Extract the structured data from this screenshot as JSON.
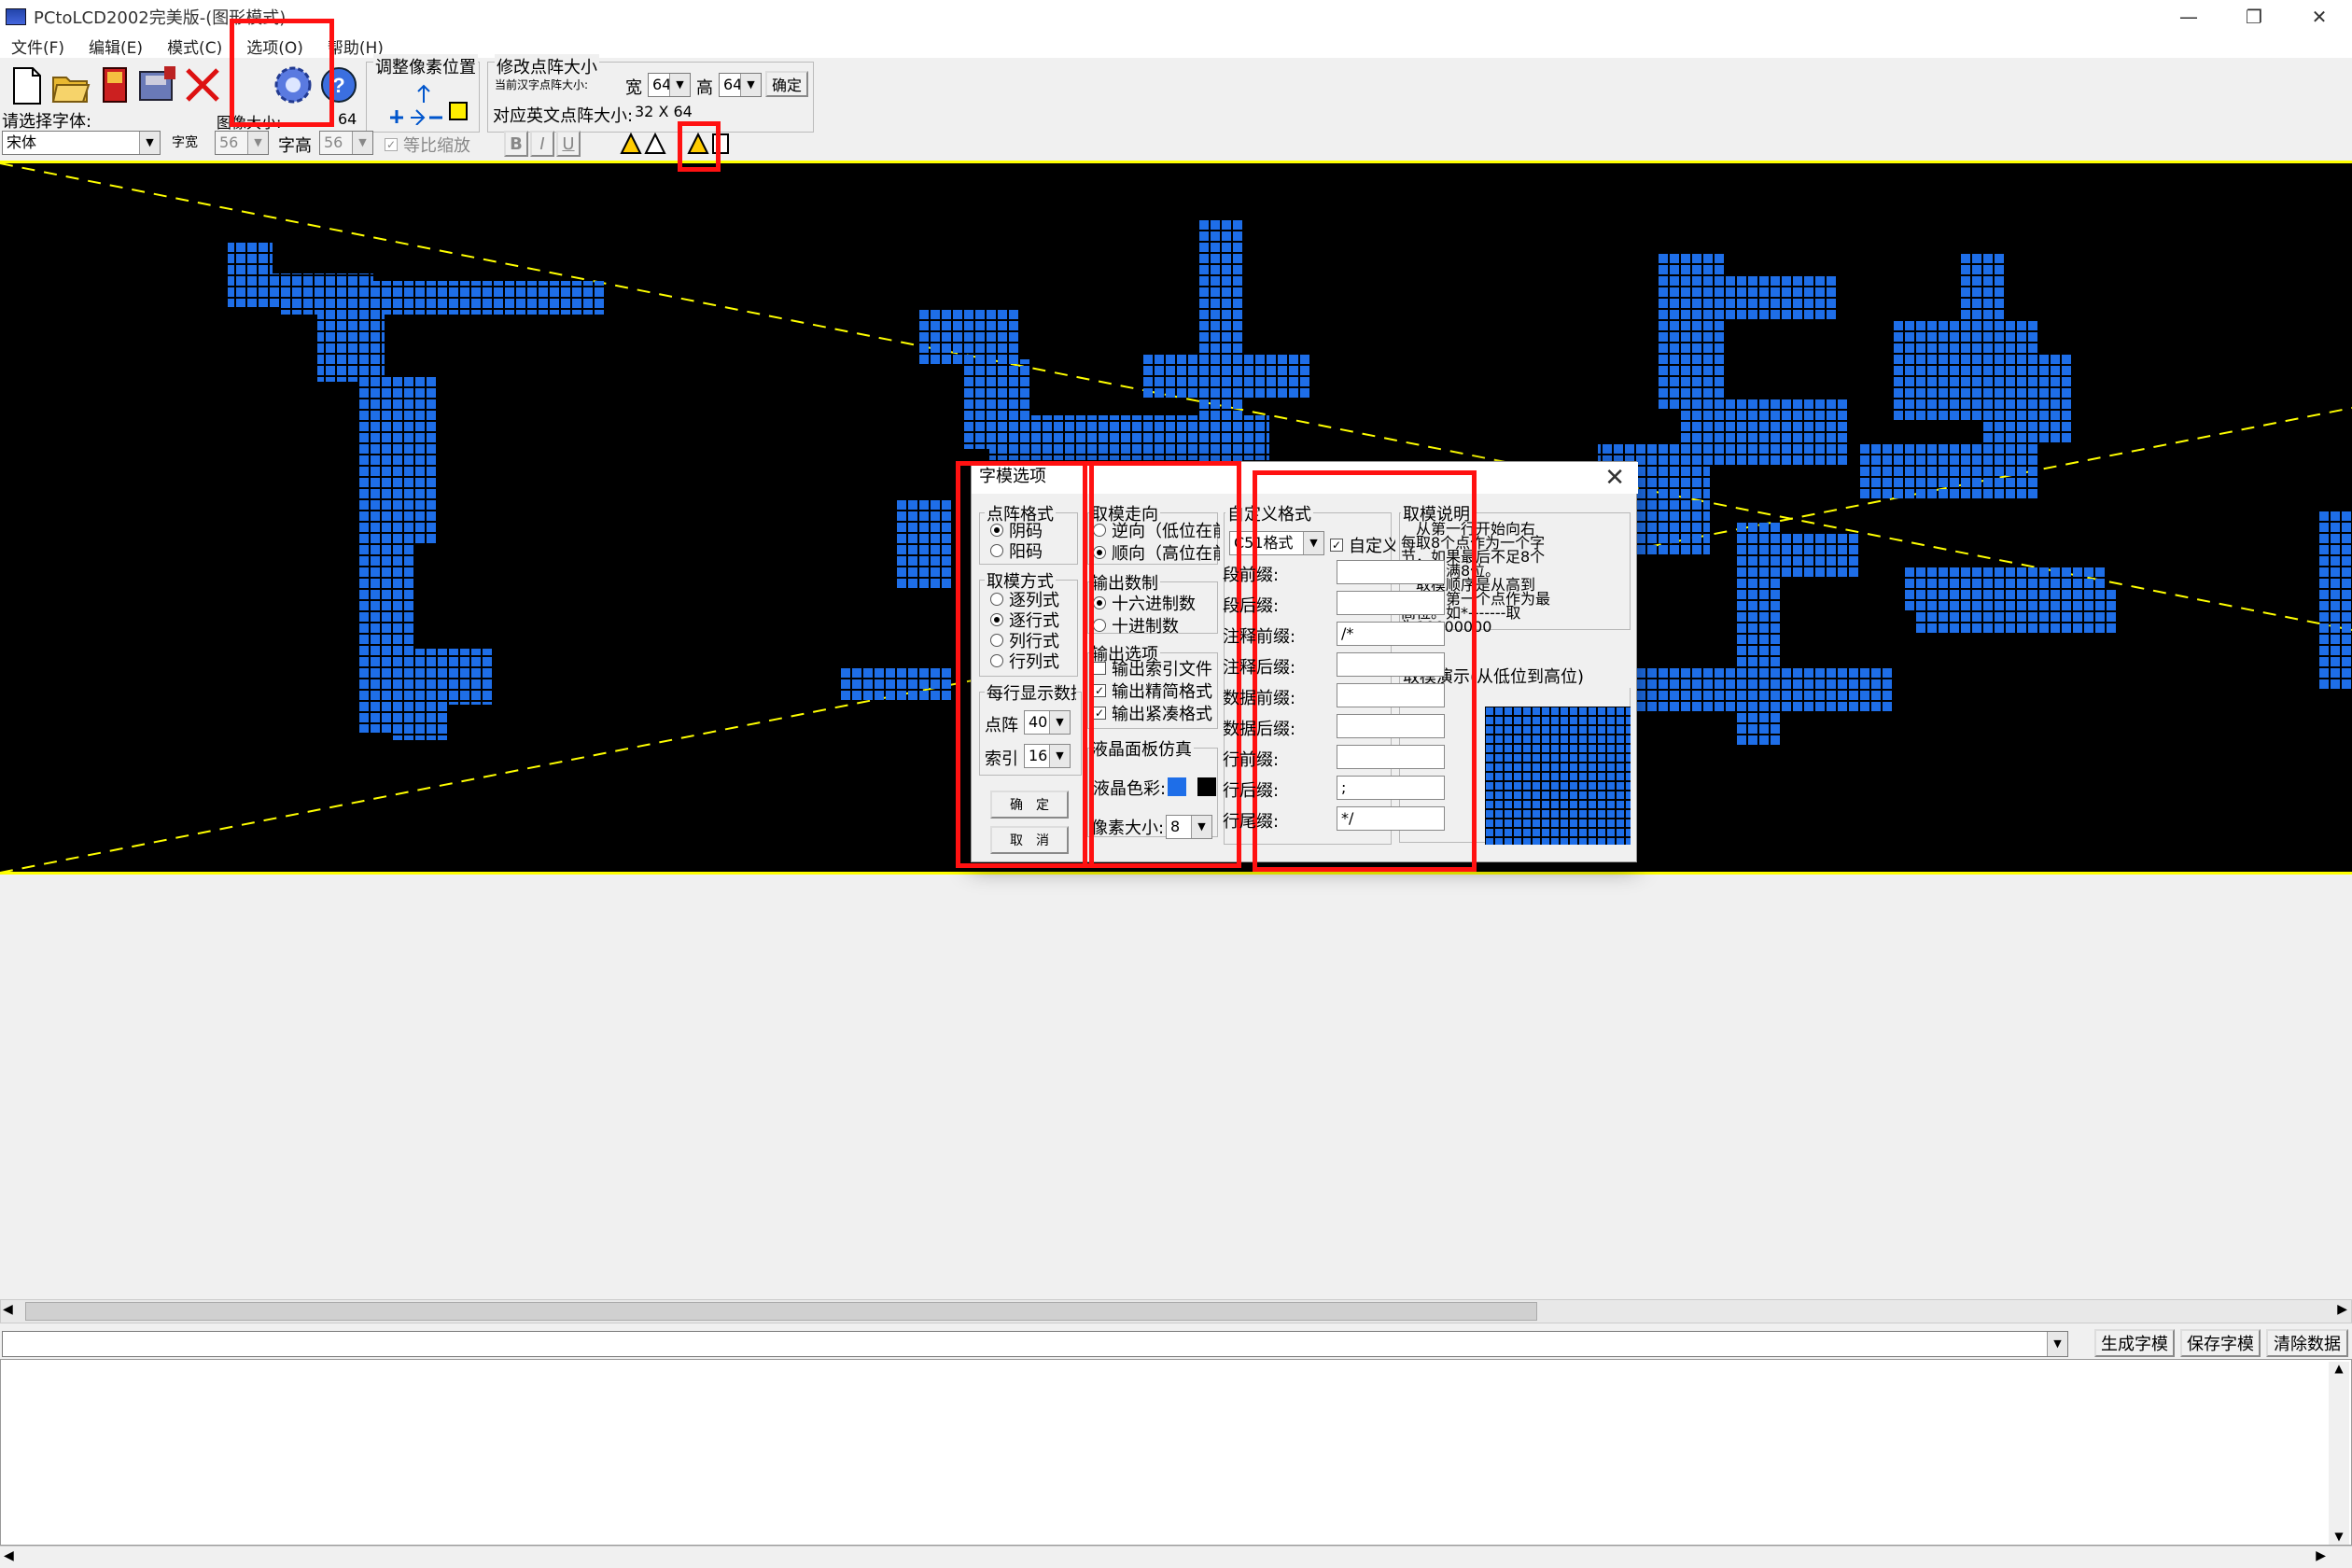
{
  "window": {
    "title": "PCtoLCD2002完美版-(图形模式)",
    "minimize": "—",
    "maximize": "❐",
    "close": "✕"
  },
  "menu": [
    "文件(F)",
    "编辑(E)",
    "模式(C)",
    "选项(O)",
    "帮助(H)"
  ],
  "toolbar": {
    "adjust_pixel_label": "调整像素位置",
    "modify_dot_label": "修改点阵大小",
    "current_char_label": "当前汉字点阵大小:",
    "width_label": "宽",
    "width_value": "64",
    "height_label": "高",
    "height_value": "64",
    "confirm_label": "确定",
    "english_size_label": "对应英文点阵大小:",
    "english_size_value": "32 X 64",
    "font_select_label": "请选择字体:",
    "font_value": "宋体",
    "char_width_label": "字宽",
    "char_width_value": "56",
    "char_height_label": "字高",
    "char_height_value": "56",
    "proportional_label": "等比缩放",
    "image_size_label": "图像大小:",
    "image_size_value": "64",
    "bold": "B",
    "italic": "I",
    "underline": "U"
  },
  "colors": {
    "pixel": "#1e6ee8",
    "canvas": "#000000",
    "guide": "#ffff00",
    "highlight": "#ff1111"
  },
  "dialog": {
    "title": "字模选项",
    "close": "✕",
    "dot_format": {
      "label": "点阵格式",
      "options": [
        "阴码",
        "阳码"
      ],
      "selected": 0
    },
    "mode": {
      "label": "取模方式",
      "options": [
        "逐列式",
        "逐行式",
        "列行式",
        "行列式"
      ],
      "selected": 1
    },
    "per_line": {
      "label": "每行显示数据",
      "dot_label": "点阵",
      "dot_value": "40",
      "index_label": "索引",
      "index_value": "16"
    },
    "ok": "确　定",
    "cancel": "取　消",
    "direction": {
      "label": "取模走向",
      "options": [
        "逆向（低位在前）",
        "顺向（高位在前）"
      ],
      "selected": 1
    },
    "radix": {
      "label": "输出数制",
      "options": [
        "十六进制数",
        "十进制数"
      ],
      "selected": 0
    },
    "output": {
      "label": "输出选项",
      "items": [
        {
          "text": "输出索引文件",
          "checked": false
        },
        {
          "text": "输出精简格式",
          "checked": true
        },
        {
          "text": "输出紧凑格式",
          "checked": true
        }
      ]
    },
    "lcd": {
      "label": "液晶面板仿真",
      "color_label": "液晶色彩:",
      "pixel_size_label": "像素大小:",
      "pixel_size_value": "8"
    },
    "custom": {
      "label": "自定义格式",
      "format_value": "C51格式",
      "custom_check": "自定义格式",
      "fields": [
        {
          "label": "段前缀:",
          "value": ""
        },
        {
          "label": "段后缀:",
          "value": ""
        },
        {
          "label": "注释前缀:",
          "value": "/*"
        },
        {
          "label": "注释后缀:",
          "value": ""
        },
        {
          "label": "数据前缀:",
          "value": ""
        },
        {
          "label": "数据后缀:",
          "value": ""
        },
        {
          "label": "行前缀:",
          "value": ""
        },
        {
          "label": "行后缀:",
          "value": ";"
        },
        {
          "label": "行尾缀:",
          "value": "*/"
        }
      ]
    },
    "explain": {
      "label": "取模说明",
      "lines": [
        "　从第一行开始向右",
        "每取8个点作为一个字",
        "节，如果最后不足8个",
        "点就补满8位。",
        "　取模顺序是从高到",
        "低，即第一个点作为最",
        "高位。如*-------取",
        "为10000000"
      ]
    },
    "demo": {
      "label": "取模演示(从低位到高位)"
    }
  },
  "buttons": {
    "generate": "生成字模",
    "save": "保存字模",
    "clear": "清除数据"
  }
}
